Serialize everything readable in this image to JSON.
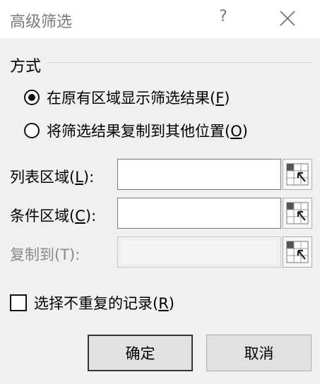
{
  "window": {
    "title": "高级筛选",
    "help_label": "?"
  },
  "method": {
    "group_label": "方式",
    "options": [
      {
        "label_pre": "在原有区域显示筛选结果(",
        "accel": "F",
        "label_post": ")",
        "checked": true
      },
      {
        "label_pre": "将筛选结果复制到其他位置(",
        "accel": "O",
        "label_post": ")",
        "checked": false
      }
    ]
  },
  "fields": {
    "list_range": {
      "label_pre": "列表区域(",
      "accel": "L",
      "label_post": "):",
      "value": ""
    },
    "criteria_range": {
      "label_pre": "条件区域(",
      "accel": "C",
      "label_post": "):",
      "value": ""
    },
    "copy_to": {
      "label": "复制到(T):",
      "value": "",
      "disabled": true
    }
  },
  "unique": {
    "label_pre": "选择不重复的记录(",
    "accel": "R",
    "label_post": ")",
    "checked": false
  },
  "buttons": {
    "ok": "确定",
    "cancel": "取消"
  },
  "icons": {
    "ref_button_icon": "range-select-icon",
    "close_icon": "close-icon"
  }
}
